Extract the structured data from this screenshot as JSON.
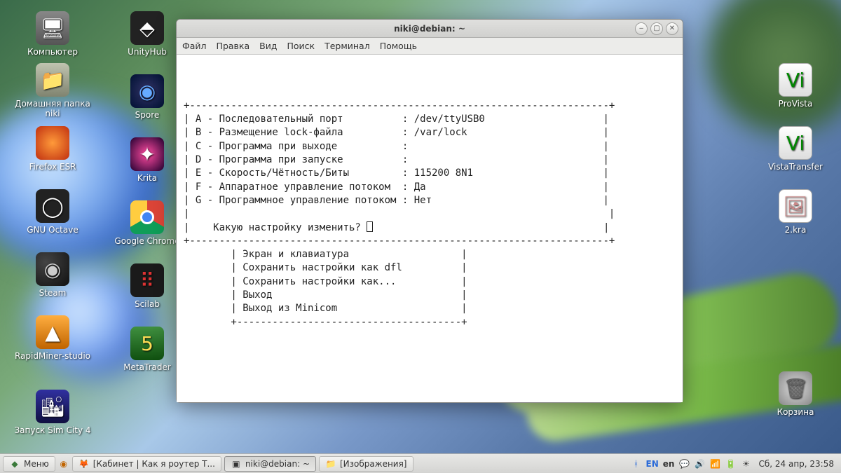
{
  "desktop_icons_left": [
    {
      "label": "Компьютер",
      "cls": "gi-monitor",
      "glyph": "🖥"
    },
    {
      "label": "Домашняя папка niki",
      "cls": "gi-folder",
      "glyph": "📁"
    },
    {
      "label": "Firefox ESR",
      "cls": "gi-firefox",
      "glyph": ""
    },
    {
      "label": "GNU Octave",
      "cls": "gi-octave",
      "glyph": "◯"
    },
    {
      "label": "Steam",
      "cls": "gi-steam",
      "glyph": "◉"
    },
    {
      "label": "RapidMiner-studio",
      "cls": "gi-rapid",
      "glyph": "▲"
    },
    {
      "label": "Запуск Sim City 4",
      "cls": "gi-simcity",
      "glyph": "🏙"
    }
  ],
  "desktop_icons_col2": [
    {
      "label": "UnityHub",
      "cls": "gi-unity",
      "glyph": "⬘"
    },
    {
      "label": "Spore",
      "cls": "gi-spore",
      "glyph": "◉"
    },
    {
      "label": "Krita",
      "cls": "gi-krita",
      "glyph": "✦"
    },
    {
      "label": "Google Chrome",
      "cls": "gi-chrome",
      "glyph": ""
    },
    {
      "label": "Scilab",
      "cls": "gi-scilab",
      "glyph": "⠿"
    },
    {
      "label": "MetaTrader",
      "cls": "gi-meta",
      "glyph": "5"
    }
  ],
  "desktop_icons_right": [
    {
      "label": "ProVista",
      "cls": "gi-provista",
      "glyph": "Vi"
    },
    {
      "label": "VistaTransfer",
      "cls": "gi-vistat",
      "glyph": "Vi"
    },
    {
      "label": "2.kra",
      "cls": "gi-kra",
      "glyph": "🖼"
    },
    {
      "label": "Корзина",
      "cls": "gi-trash",
      "glyph": "🗑"
    }
  ],
  "window": {
    "title": "niki@debian: ~",
    "menu": [
      "Файл",
      "Правка",
      "Вид",
      "Поиск",
      "Терминал",
      "Помощь"
    ]
  },
  "terminal": {
    "top_border": "+-----------------------------------------------------------------------+",
    "rows": [
      {
        "key": "A",
        "label": "Последовательный порт",
        "value": "/dev/ttyUSB0"
      },
      {
        "key": "B",
        "label": "Размещение lock-файла",
        "value": "/var/lock"
      },
      {
        "key": "C",
        "label": "Программа при выходе",
        "value": ""
      },
      {
        "key": "D",
        "label": "Программа при запуске",
        "value": ""
      },
      {
        "key": "E",
        "label": "Скорость/Чётность/Биты",
        "value": "115200 8N1"
      },
      {
        "key": "F",
        "label": "Аппаратное управление потоком",
        "value": "Да"
      },
      {
        "key": "G",
        "label": "Программное управление потоком",
        "value": "Нет"
      }
    ],
    "prompt": "Какую настройку изменить?",
    "bottom_border": "+-----------------------------------------------------------------------+",
    "submenu_border_top": "        +--------------------------------------+",
    "submenu": [
      "Экран и клавиатура",
      "Сохранить настройки как dfl",
      "Сохранить настройки как...",
      "Выход",
      "Выход из Minicom"
    ],
    "submenu_border_bot": "        +--------------------------------------+"
  },
  "taskbar": {
    "menu_label": "Меню",
    "items": [
      {
        "icon": "🦊",
        "label": "[Кабинет | Как я роутер Т...",
        "active": false
      },
      {
        "icon": "▣",
        "label": "niki@debian: ~",
        "active": true
      },
      {
        "icon": "📁",
        "label": "[Изображения]",
        "active": false
      }
    ],
    "lang1": "EN",
    "lang2": "en",
    "clock": "Сб, 24 апр, 23:58"
  }
}
